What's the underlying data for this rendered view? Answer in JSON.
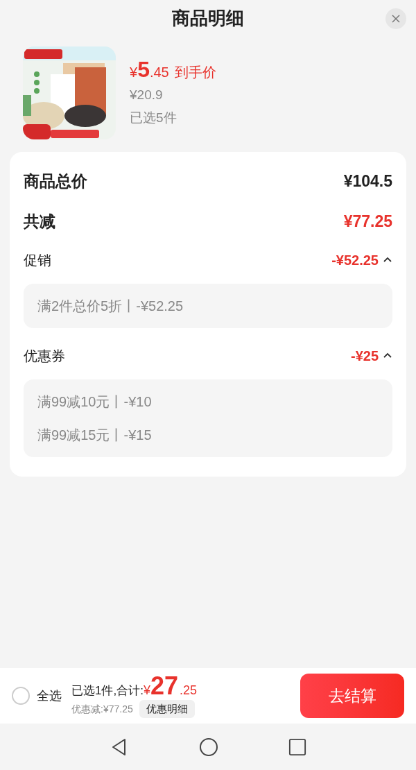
{
  "header": {
    "title": "商品明细"
  },
  "product": {
    "currency": "¥",
    "price_int": "5",
    "price_dec": ".45",
    "price_label": "到手价",
    "original_price": "¥20.9",
    "selected_count": "已选5件"
  },
  "summary": {
    "total": {
      "label": "商品总价",
      "value": "¥104.5"
    },
    "discount": {
      "label": "共减",
      "value": "¥77.25"
    }
  },
  "sections": [
    {
      "title": "促销",
      "amount": "-¥52.25",
      "expanded": true,
      "items": [
        "满2件总价5折丨-¥52.25"
      ]
    },
    {
      "title": "优惠券",
      "amount": "-¥25",
      "expanded": true,
      "items": [
        "满99减10元丨-¥10",
        "满99减15元丨-¥15"
      ]
    }
  ],
  "bottom_bar": {
    "select_all": {
      "label": "全选",
      "checked": false
    },
    "total_label": "已选1件,合计:",
    "currency": "¥",
    "total_int": "27",
    "total_dec": ".25",
    "saving": "优惠减:¥77.25",
    "detail_button": "优惠明细",
    "checkout": "去结算"
  }
}
